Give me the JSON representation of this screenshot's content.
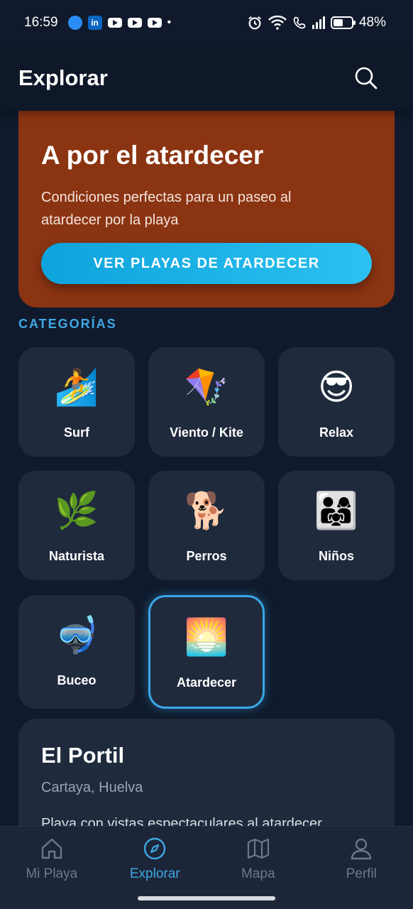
{
  "status_bar": {
    "time": "16:59",
    "battery": "48%",
    "battery_level": 0.48,
    "notification_icons": [
      "cloud-icon",
      "linkedin-icon",
      "youtube-icon",
      "youtube-icon",
      "youtube-icon"
    ],
    "system_icons": [
      "alarm-icon",
      "wifi-icon",
      "call-icon",
      "signal-icon",
      "battery-icon"
    ]
  },
  "header": {
    "title": "Explorar",
    "search_icon": "search-icon"
  },
  "promo": {
    "title": "A por el atardecer",
    "description": "Condiciones perfectas para un paseo al atardecer por la playa",
    "button_label": "VER PLAYAS DE ATARDECER",
    "background_color": "#8b3412",
    "button_color": "#1fb3e8"
  },
  "categories": {
    "section_label": "CATEGORÍAS",
    "items": [
      {
        "label": "Surf",
        "emoji": "🏄"
      },
      {
        "label": "Viento / Kite",
        "emoji": "🪁"
      },
      {
        "label": "Relax",
        "emoji": "😎"
      },
      {
        "label": "Naturista",
        "emoji": "🌿"
      },
      {
        "label": "Perros",
        "emoji": "🐕"
      },
      {
        "label": "Niños",
        "emoji": "👨‍👩‍👧"
      },
      {
        "label": "Buceo",
        "emoji": "🤿"
      },
      {
        "label": "Atardecer",
        "emoji": "🌅",
        "selected": true
      }
    ]
  },
  "beach_card": {
    "name": "El Portil",
    "location": "Cartaya, Huelva",
    "description": "Playa con vistas espectaculares al atardecer"
  },
  "bottom_nav": {
    "items": [
      {
        "label": "Mi Playa",
        "icon": "home-icon"
      },
      {
        "label": "Explorar",
        "icon": "compass-icon",
        "active": true
      },
      {
        "label": "Mapa",
        "icon": "map-icon"
      },
      {
        "label": "Perfil",
        "icon": "person-icon"
      }
    ]
  },
  "colors": {
    "background": "#101a2c",
    "card": "#1f2a3d",
    "accent": "#3fa8e4"
  }
}
